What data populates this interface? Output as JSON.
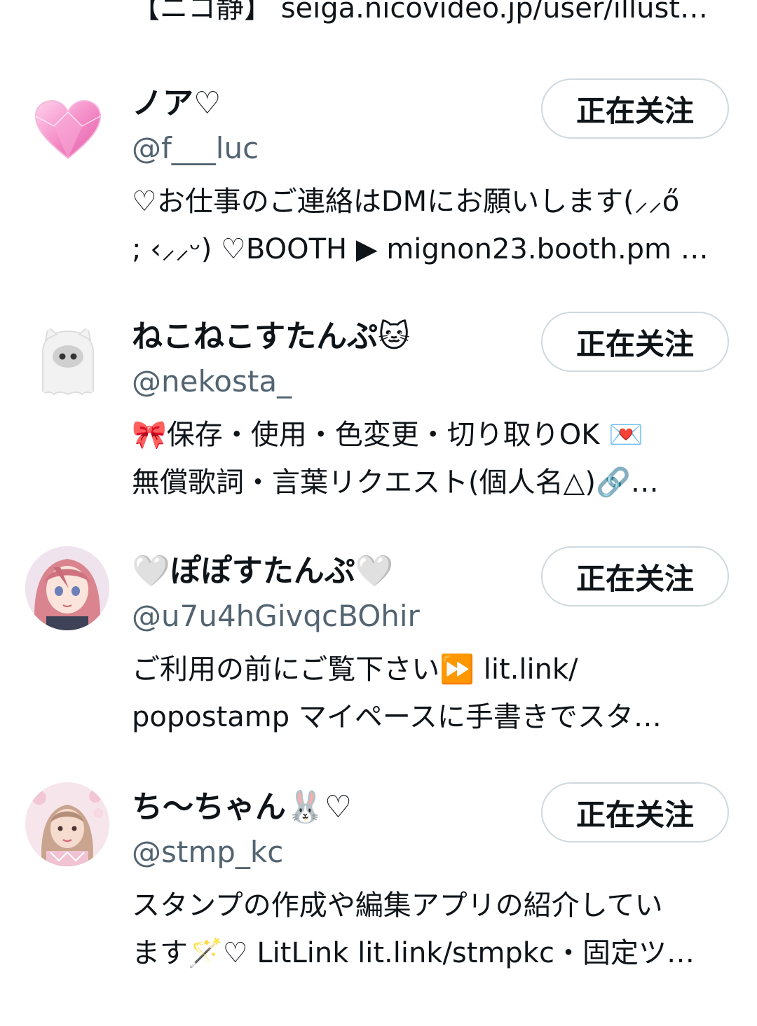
{
  "top_bio": "【ニコ静】 seiga.nicovideo.jp/user/illust…",
  "users": [
    {
      "display_name": "ノア♡",
      "handle": "@f___luc",
      "bio_line1": "♡お仕事のご連絡はDMにお願いします(⸝⸝ő",
      "bio_line2": "; ‹⸝⸝ᵕ) ♡BOOTH ▶ mignon23.booth.pm …",
      "follow_label": "正在关注",
      "avatar_icon": "pink-heart-gem-icon"
    },
    {
      "display_name": "ねこねこすたんぷ🐱",
      "handle": "@nekosta_",
      "bio_line1": "🎀保存・使用・色変更・切り取りOK 💌",
      "bio_line2": "無償歌詞・言葉リクエスト(個人名△)🔗…",
      "follow_label": "正在关注",
      "avatar_icon": "white-ghost-cat-icon"
    },
    {
      "display_name": "🤍ぽぽすたんぷ🤍",
      "handle": "@u7u4hGivqcBOhir",
      "bio_line1": "ご利用の前にご覧下さい⏩ lit.link/",
      "bio_line2": "popostamp マイペースに手書きでスタ…",
      "follow_label": "正在关注",
      "avatar_icon": "anime-girl-avatar"
    },
    {
      "display_name": "ち〜ちゃん🐰♡",
      "handle": "@stmp_kc",
      "bio_line1": "スタンプの作成や編集アプリの紹介してい",
      "bio_line2": "ます🪄♡ LitLink lit.link/stmpkc・固定ツ…",
      "follow_label": "正在关注",
      "avatar_icon": "photo-girl-avatar"
    }
  ]
}
